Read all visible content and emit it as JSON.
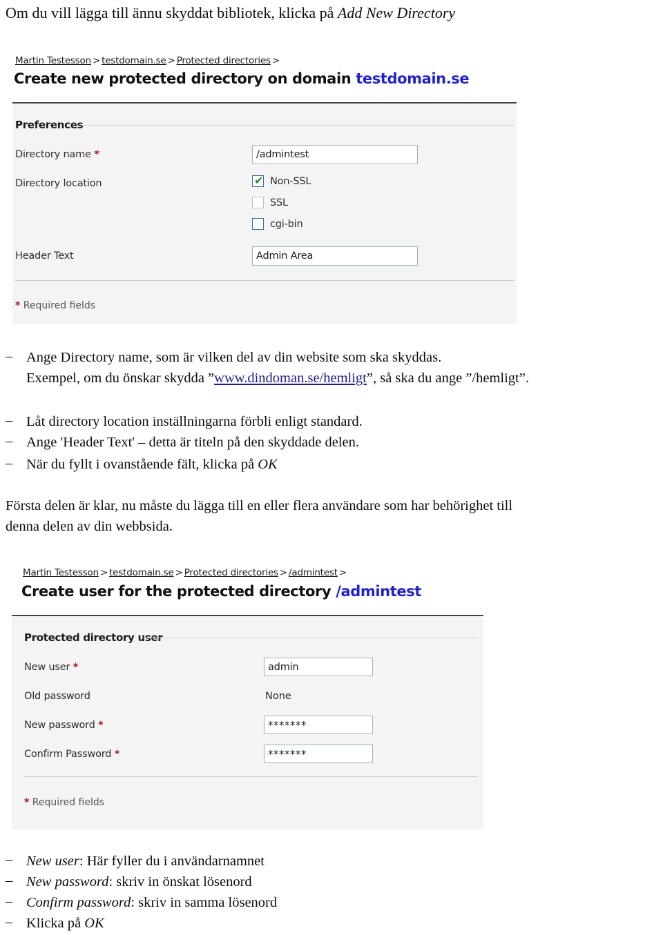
{
  "document": {
    "intro": {
      "plain": "Om du vill lägga till ännu skyddat bibliotek, klicka på ",
      "emphasis": "Add New Directory"
    },
    "bullets_first": {
      "marker": "–",
      "item1_line1": "Ange Directory name, som är vilken del av din website som ska skyddas.",
      "item1_line2_pre": "Exempel, om du önskar skydda ”",
      "item1_link": "www.dindoman.se/hemligt",
      "item1_line2_post": "”, så ska du ange ”/hemligt”.",
      "item2": "Låt directory location inställningarna förbli enligt standard.",
      "item3": "Ange 'Header Text' – detta är titeln på den skyddade delen.",
      "item4_pre": "När du fyllt i ovanstående fält, klicka på ",
      "item4_em": "OK"
    },
    "paragraph": {
      "line1": "Första delen är klar, nu måste du lägga till en eller flera användare som har behörighet till",
      "line2": "denna delen av din webbsida."
    },
    "bullets_second": {
      "marker": "–",
      "item1_em": "New user",
      "item1_rest": ": Här fyller du i användarnamnet",
      "item2_em": "New password",
      "item2_rest": ": skriv in önskat lösenord",
      "item3_em": "Confirm password",
      "item3_rest": ": skriv in samma lösenord",
      "item4_pre": "Klicka på ",
      "item4_em": "OK"
    }
  },
  "screenshot_one": {
    "breadcrumb": {
      "item1": "Martin Testesson",
      "item2": "testdomain.se",
      "item3": "Protected directories",
      "separator": ">",
      "trailing": ">"
    },
    "title": {
      "prefix": "Create new protected directory on domain ",
      "domain": "testdomain.se"
    },
    "section_title": "Preferences",
    "fields": {
      "directory_name_label": "Directory name",
      "directory_name_value": "/admintest",
      "directory_location_label": "Directory location",
      "header_text_label": "Header Text",
      "header_text_value": "Admin Area"
    },
    "checkboxes": [
      {
        "label": "Non-SSL",
        "checked": true,
        "tick": "✔"
      },
      {
        "label": "SSL",
        "checked": false,
        "tick": ""
      },
      {
        "label": "cgi-bin",
        "checked": false,
        "tick": ""
      }
    ],
    "required_marker": "*",
    "required_note": " Required fields"
  },
  "screenshot_two": {
    "breadcrumb": {
      "item1": "Martin Testesson",
      "item2": "testdomain.se",
      "item3": "Protected directories",
      "item4": "/admintest",
      "separator": ">",
      "trailing": ">"
    },
    "title": {
      "prefix": "Create user for the protected directory ",
      "directory": "/admintest"
    },
    "section_title": "Protected directory user",
    "fields": {
      "new_user_label": "New user",
      "new_user_value": "admin",
      "old_password_label": "Old password",
      "old_password_value": "None",
      "new_password_label": "New password",
      "new_password_value": "*******",
      "confirm_password_label": "Confirm Password",
      "confirm_password_value": "*******"
    },
    "required_marker": "*",
    "required_note": " Required fields"
  },
  "colors": {
    "link": "#1c1c8c",
    "title_accent": "#2222cc",
    "required_star": "#a41b1b",
    "panel_background": "#f4f4f4",
    "check_green": "#1f8a2f"
  }
}
